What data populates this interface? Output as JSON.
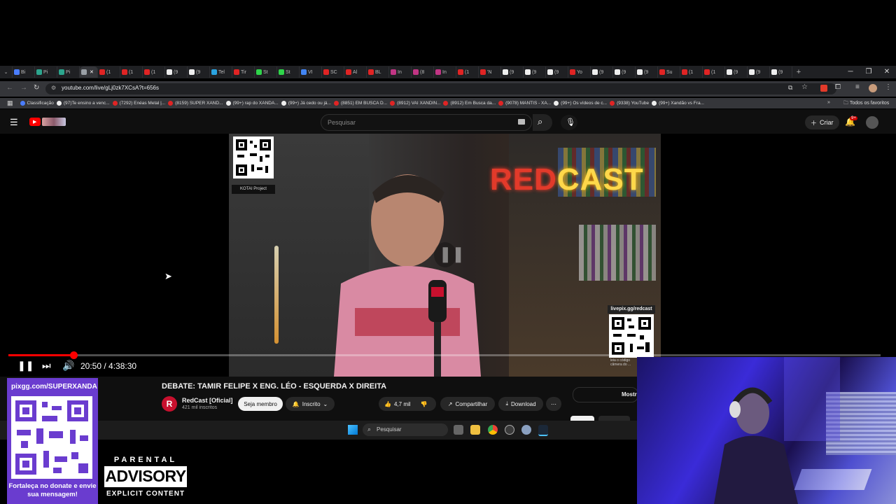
{
  "browser": {
    "tabs": [
      {
        "label": "Bi",
        "color": "#4a7dff"
      },
      {
        "label": "Pi",
        "color": "#2ca58d"
      },
      {
        "label": "Pi",
        "color": "#2ca58d"
      },
      {
        "label": "",
        "color": "#9aa0a6",
        "active": true
      },
      {
        "label": "(1",
        "color": "#e02424"
      },
      {
        "label": "(1",
        "color": "#e02424"
      },
      {
        "label": "(1",
        "color": "#e02424"
      },
      {
        "label": "(9",
        "color": "#eeeeee"
      },
      {
        "label": "(9",
        "color": "#eeeeee"
      },
      {
        "label": "Tel",
        "color": "#2aa3e0"
      },
      {
        "label": "Tir",
        "color": "#e02424"
      },
      {
        "label": "St",
        "color": "#2fd44a"
      },
      {
        "label": "St",
        "color": "#2fd44a"
      },
      {
        "label": "VI",
        "color": "#4285f4"
      },
      {
        "label": "SC",
        "color": "#e02424"
      },
      {
        "label": "Al",
        "color": "#e02424"
      },
      {
        "label": "BL",
        "color": "#e02424"
      },
      {
        "label": "In",
        "color": "#c13584"
      },
      {
        "label": "(8",
        "color": "#c13584"
      },
      {
        "label": "In",
        "color": "#c13584"
      },
      {
        "label": "(1",
        "color": "#e02424"
      },
      {
        "label": "'N",
        "color": "#e02424"
      },
      {
        "label": "(9",
        "color": "#eeeeee"
      },
      {
        "label": "(9",
        "color": "#eeeeee"
      },
      {
        "label": "(9",
        "color": "#eeeeee"
      },
      {
        "label": "Yo",
        "color": "#e02424"
      },
      {
        "label": "(9",
        "color": "#eeeeee"
      },
      {
        "label": "(9",
        "color": "#eeeeee"
      },
      {
        "label": "(9",
        "color": "#eeeeee"
      },
      {
        "label": "Su",
        "color": "#e02424"
      },
      {
        "label": "(1",
        "color": "#e02424"
      },
      {
        "label": "(1",
        "color": "#e02424"
      },
      {
        "label": "(9",
        "color": "#eeeeee"
      },
      {
        "label": "(9",
        "color": "#eeeeee"
      },
      {
        "label": "(9",
        "color": "#eeeeee"
      }
    ],
    "url": "youtube.com/live/gLj0zk7XCsA?t=656s",
    "bookmarks": [
      {
        "label": "Classificação",
        "color": "#4a7dff"
      },
      {
        "label": "(97)Te ensino a venc...",
        "color": "#eeeeee"
      },
      {
        "label": "(7292) Enéas Metal |...",
        "color": "#e02424"
      },
      {
        "label": "(8159) SUPER XAND...",
        "color": "#e02424"
      },
      {
        "label": "(99+) rap do XANDÃ...",
        "color": "#eeeeee"
      },
      {
        "label": "(99+) Já cedo ou já...",
        "color": "#eeeeee"
      },
      {
        "label": "(8851) EM BUSCA D...",
        "color": "#e02424"
      },
      {
        "label": "(8912) VAI XANDIN...",
        "color": "#e02424"
      },
      {
        "label": "(8912) Em Busca da...",
        "color": "#e02424"
      },
      {
        "label": "(9078) MANTIS - XA...",
        "color": "#e02424"
      },
      {
        "label": "(99+) Os vídeos de c...",
        "color": "#eeeeee"
      },
      {
        "label": "(9338) YouTube",
        "color": "#e02424"
      },
      {
        "label": "(99+) Xandão vs Fra...",
        "color": "#eeeeee"
      }
    ],
    "all_bookmarks": "Todos os favoritos"
  },
  "youtube": {
    "search_placeholder": "Pesquisar",
    "create_label": "Criar",
    "notif_count": "9+",
    "video_overlay": {
      "qr_caption_top": "KOTAI Project",
      "neon_red": "RED",
      "neon_yellow": "CAST",
      "qr_caption_right": "livepix.gg/redcast",
      "qr_bottom_text": "leia o código\ncâmera do ..."
    },
    "player": {
      "time": "20:50 / 4:38:30",
      "progress_fraction": 0.075
    },
    "title": "DEBATE: TAMIR FELIPE X ENG. LÉO - ESQUERDA X DIREITA",
    "channel": {
      "initial": "R",
      "name": "RedCast [Oficial]",
      "subs": "421 mil inscritos"
    },
    "member_btn": "Seja membro",
    "subscribed_btn": "Inscrito",
    "likes": "4,7 mil",
    "share": "Compartilhar",
    "download": "Download",
    "right_label": "Mostr"
  },
  "taskbar": {
    "search": "Pesquisar"
  },
  "overlay": {
    "donate_url": "pixgg.com/SUPERXANDA",
    "donate_msg": "Fortaleça no donate e envie sua mensagem!",
    "pa_top": "PARENTAL",
    "pa_mid": "ADVISORY",
    "pa_bottom": "EXPLICIT CONTENT"
  }
}
